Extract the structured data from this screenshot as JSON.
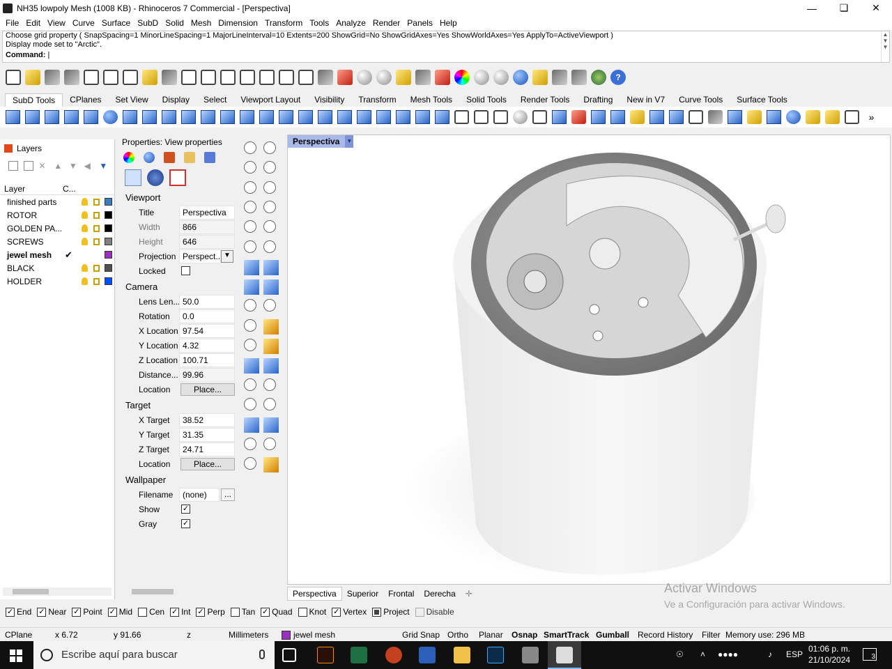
{
  "window": {
    "title": "NH35 lowpoly Mesh (1008 KB) - Rhinoceros 7 Commercial - [Perspectiva]"
  },
  "menu": [
    "File",
    "Edit",
    "View",
    "Curve",
    "Surface",
    "SubD",
    "Solid",
    "Mesh",
    "Dimension",
    "Transform",
    "Tools",
    "Analyze",
    "Render",
    "Panels",
    "Help"
  ],
  "command": {
    "history_1": "Choose grid property ( SnapSpacing=1  MinorLineSpacing=1  MajorLineInterval=10  Extents=200  ShowGrid=No  ShowGridAxes=Yes  ShowWorldAxes=Yes  ApplyTo=ActiveViewport )",
    "history_2": "Display mode set to \"Arctic\".",
    "prompt": "Command:"
  },
  "toolbar_tabs": [
    "SubD Tools",
    "CPlanes",
    "Set View",
    "Display",
    "Select",
    "Viewport Layout",
    "Visibility",
    "Transform",
    "Mesh Tools",
    "Solid Tools",
    "Render Tools",
    "Drafting",
    "New in V7",
    "Curve Tools",
    "Surface Tools"
  ],
  "layers_panel": {
    "title": "Layers",
    "col_layer": "Layer",
    "col_color": "C...",
    "rows": [
      {
        "name": "finished parts",
        "color": "#3a7fbf",
        "current": false
      },
      {
        "name": "ROTOR",
        "color": "#000000",
        "current": false
      },
      {
        "name": "GOLDEN PA...",
        "color": "#000000",
        "current": false
      },
      {
        "name": "SCREWS",
        "color": "#808080",
        "current": false
      },
      {
        "name": "jewel mesh",
        "color": "#9b30c0",
        "current": true
      },
      {
        "name": "BLACK",
        "color": "#505050",
        "current": false
      },
      {
        "name": "HOLDER",
        "color": "#0050ff",
        "current": false
      }
    ]
  },
  "properties_panel": {
    "title": "Properties: View properties",
    "sections": {
      "viewport": "Viewport",
      "camera": "Camera",
      "target": "Target",
      "wallpaper": "Wallpaper"
    },
    "viewport": {
      "title_label": "Title",
      "title_value": "Perspectiva",
      "width_label": "Width",
      "width_value": "866",
      "height_label": "Height",
      "height_value": "646",
      "projection_label": "Projection",
      "projection_value": "Perspect...",
      "locked_label": "Locked",
      "locked": false
    },
    "camera": {
      "lens_label": "Lens Len...",
      "lens_value": "50.0",
      "rotation_label": "Rotation",
      "rotation_value": "0.0",
      "x_label": "X Location",
      "x_value": "97.54",
      "y_label": "Y Location",
      "y_value": "4.32",
      "z_label": "Z Location",
      "z_value": "100.71",
      "distance_label": "Distance...",
      "distance_value": "99.96",
      "location_label": "Location",
      "location_button": "Place..."
    },
    "target": {
      "x_label": "X Target",
      "x_value": "38.52",
      "y_label": "Y Target",
      "y_value": "31.35",
      "z_label": "Z Target",
      "z_value": "24.71",
      "location_label": "Location",
      "location_button": "Place..."
    },
    "wallpaper": {
      "filename_label": "Filename",
      "filename_value": "(none)",
      "browse": "...",
      "show_label": "Show",
      "show": true,
      "gray_label": "Gray",
      "gray": true
    }
  },
  "viewport": {
    "active_title": "Perspectiva",
    "tabs": [
      "Perspectiva",
      "Superior",
      "Frontal",
      "Derecha"
    ]
  },
  "watermark": {
    "line1": "Activar Windows",
    "line2": "Ve a Configuración para activar Windows."
  },
  "osnap": [
    {
      "label": "End",
      "checked": true
    },
    {
      "label": "Near",
      "checked": true
    },
    {
      "label": "Point",
      "checked": true
    },
    {
      "label": "Mid",
      "checked": true
    },
    {
      "label": "Cen",
      "checked": false
    },
    {
      "label": "Int",
      "checked": true
    },
    {
      "label": "Perp",
      "checked": true
    },
    {
      "label": "Tan",
      "checked": false
    },
    {
      "label": "Quad",
      "checked": true
    },
    {
      "label": "Knot",
      "checked": false
    },
    {
      "label": "Vertex",
      "checked": true
    },
    {
      "label": "Project",
      "checked": "partial"
    },
    {
      "label": "Disable",
      "checked": false
    }
  ],
  "status": {
    "cplane": "CPlane",
    "x": "x 6.72",
    "y": "y 91.66",
    "z": "z",
    "units": "Millimeters",
    "layer": "jewel mesh",
    "layer_color": "#9b30c0",
    "grid_snap": "Grid Snap",
    "ortho": "Ortho",
    "planar": "Planar",
    "osnap": "Osnap",
    "smarttrack": "SmartTrack",
    "gumball": "Gumball",
    "record_history": "Record History",
    "filter": "Filter",
    "memory": "Memory use: 296 MB"
  },
  "taskbar": {
    "search_placeholder": "Escribe aquí para buscar",
    "lang": "ESP",
    "time": "01:06 p. m.",
    "date": "21/10/2024",
    "notifications": "3"
  }
}
